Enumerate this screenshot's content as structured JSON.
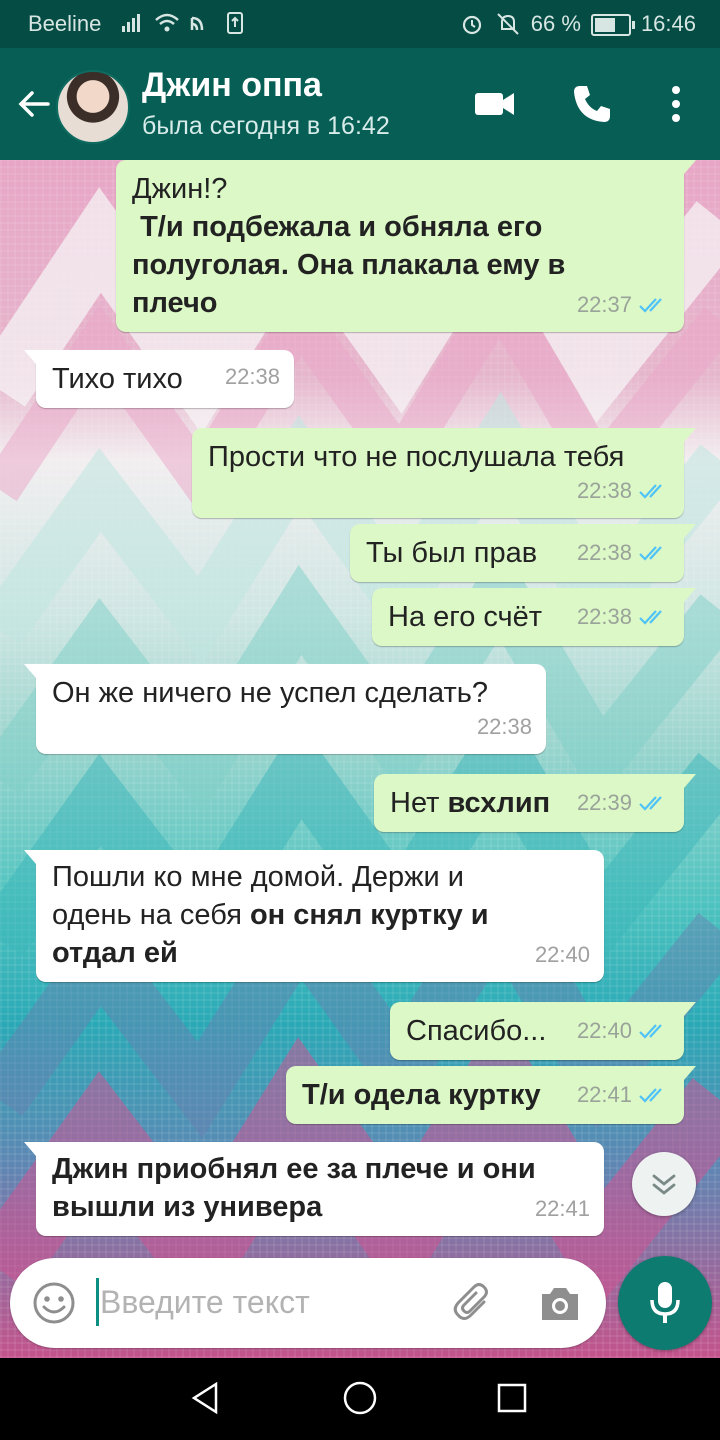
{
  "status_bar": {
    "carrier": "Beeline",
    "battery_percent": "66 %",
    "battery_level": 0.66,
    "time": "16:46",
    "icons": [
      "signal-icon",
      "wifi-icon",
      "nfc-icon",
      "sim-icon",
      "alarm-icon",
      "mute-icon",
      "battery-icon"
    ]
  },
  "header": {
    "contact_name": "Джин оппа",
    "contact_status": "была сегодня в 16:42",
    "icons": [
      "back-arrow-icon",
      "avatar",
      "video-call-icon",
      "phone-icon",
      "more-vert-icon"
    ]
  },
  "messages": [
    {
      "dir": "out",
      "text": "Джин!?",
      "bold": " Т/и подбежала и обняла его полуголая. Она плакала ему в плечо",
      "time": "22:37",
      "read": true
    },
    {
      "dir": "in",
      "text": "Тихо тихо",
      "bold": "",
      "time": "22:38"
    },
    {
      "dir": "out",
      "text": "Прости что не послушала тебя",
      "bold": "",
      "time": "22:38",
      "read": true
    },
    {
      "dir": "out",
      "text": "Ты был прав",
      "bold": "",
      "time": "22:38",
      "read": true
    },
    {
      "dir": "out",
      "text": "На его счёт",
      "bold": "",
      "time": "22:38",
      "read": true
    },
    {
      "dir": "in",
      "text": "Он же ничего не успел сделать?",
      "bold": "",
      "time": "22:38"
    },
    {
      "dir": "out",
      "text": "Нет ",
      "bold": "всхлип",
      "time": "22:39",
      "read": true
    },
    {
      "dir": "in",
      "text": "Пошли ко мне домой. Держи и одень на себя ",
      "bold": "он снял куртку и отдал ей",
      "time": "22:40"
    },
    {
      "dir": "out",
      "text": "Спасибо...",
      "bold": "",
      "time": "22:40",
      "read": true
    },
    {
      "dir": "out",
      "text": "",
      "bold": "Т/и одела куртку",
      "time": "22:41",
      "read": true
    },
    {
      "dir": "in",
      "text": "",
      "bold": "Джин приобнял ее за плече и они вышли из универа",
      "time": "22:41"
    }
  ],
  "composer": {
    "placeholder": "Введите текст",
    "icons": [
      "emoji-icon",
      "attach-icon",
      "camera-icon",
      "mic-icon"
    ]
  },
  "nav_bar": {
    "icons": [
      "back-triangle-icon",
      "home-circle-icon",
      "recents-square-icon"
    ]
  },
  "colors": {
    "header": "#075e54",
    "status_bar": "#054d44",
    "outgoing_bubble": "#dcf8c6",
    "incoming_bubble": "#ffffff",
    "read_ticks": "#4fc3f7",
    "mic_button": "#0e7b70"
  }
}
